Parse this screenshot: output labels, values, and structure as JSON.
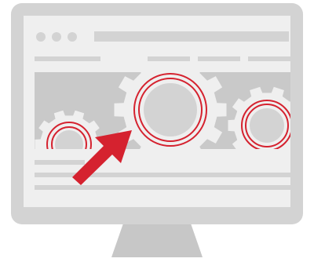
{
  "illustration": {
    "subject": "monitor-with-gears-and-pointer",
    "colors": {
      "monitor_frame": "#d3d3d3",
      "screen_bg": "#efefef",
      "placeholder_bar": "#d3d3d3",
      "hero_band": "#c9c9c9",
      "gear_fill": "#efefef",
      "gear_hub": "#d3d3d3",
      "gear_ring": "#d5222f",
      "cursor_arrow": "#d5222f",
      "stand": "#c7c7c7"
    }
  },
  "icons": [
    "window-dot-icon",
    "gear-icon",
    "cursor-arrow-icon"
  ]
}
